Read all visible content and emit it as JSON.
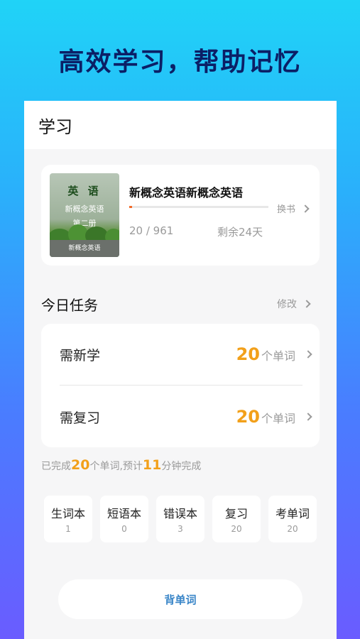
{
  "hero": {
    "title": "高效学习，帮助记忆"
  },
  "header": {
    "title": "学习"
  },
  "book": {
    "cover_title": "英 语",
    "cover_subtitle": "新概念英语",
    "cover_volume": "第二册",
    "cover_footer": "新概念英语",
    "name": "新概念英语新概念英语",
    "progress_current": 20,
    "progress_total": 961,
    "progress_text": "20 / 961",
    "remaining": "剩余24天",
    "change_label": "换书",
    "progress_color": "#f26b2a"
  },
  "today": {
    "title": "今日任务",
    "edit_label": "修改",
    "tasks": [
      {
        "label": "需新学",
        "count": "20",
        "unit": "个单词"
      },
      {
        "label": "需复习",
        "count": "20",
        "unit": "个单词"
      }
    ]
  },
  "summary": {
    "prefix": "已完成",
    "done": "20",
    "middle": "个单词,预计",
    "minutes": "11",
    "suffix": "分钟完成"
  },
  "tools": [
    {
      "label": "生词本",
      "num": "1"
    },
    {
      "label": "短语本",
      "num": "0"
    },
    {
      "label": "错误本",
      "num": "3"
    },
    {
      "label": "复习",
      "num": "20"
    },
    {
      "label": "考单词",
      "num": "20"
    }
  ],
  "cta": {
    "label": "背单词"
  },
  "colors": {
    "accent": "#f2a01a",
    "title_dark": "#0b1f66",
    "link_blue": "#3a86c8"
  }
}
